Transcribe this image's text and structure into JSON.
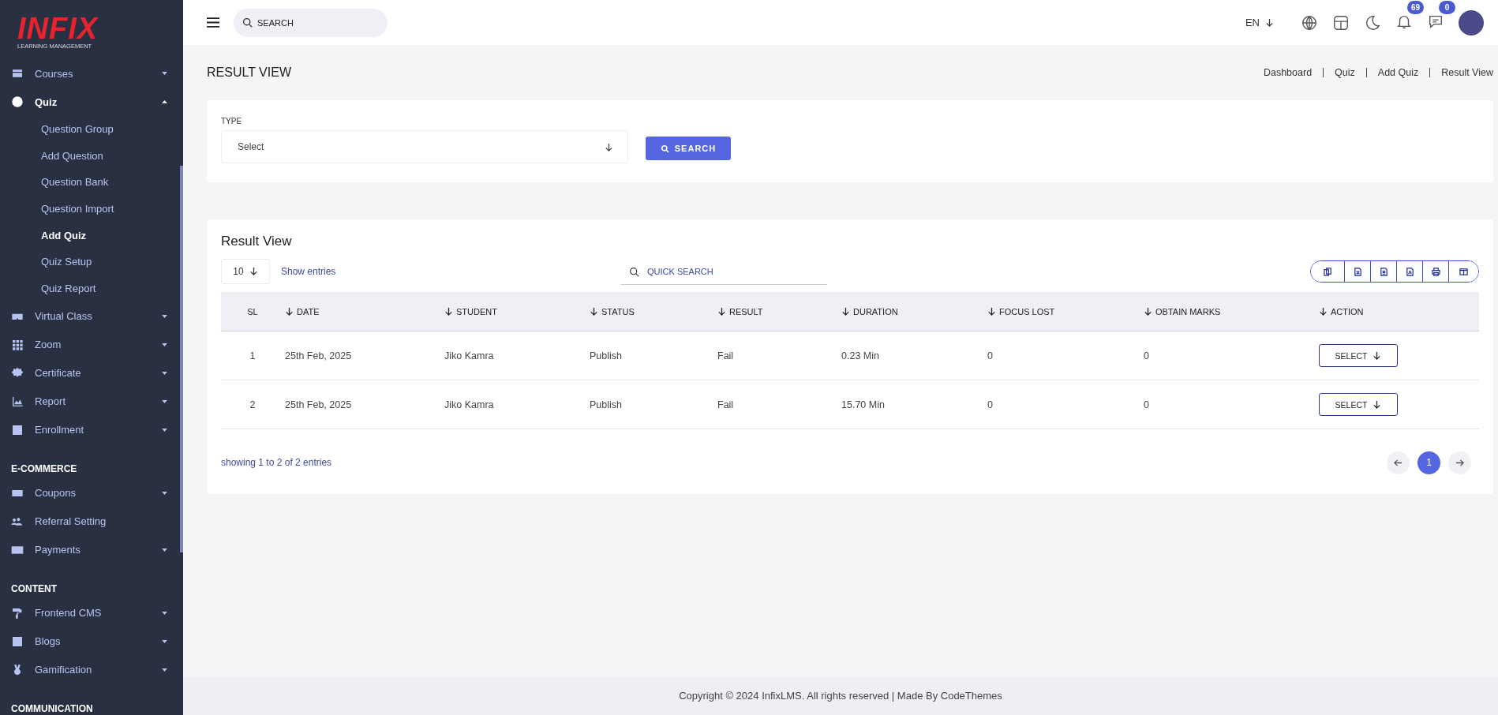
{
  "sidebar": {
    "logo": {
      "title": "INFIX",
      "subtitle": "LEARNING MANAGEMENT"
    },
    "sections": [
      {
        "items": [
          {
            "label": "Courses",
            "expanded": false,
            "selected": false
          },
          {
            "label": "Quiz",
            "expanded": true,
            "selected": true,
            "children": [
              {
                "label": "Question Group",
                "selected": false
              },
              {
                "label": "Add Question",
                "selected": false
              },
              {
                "label": "Question Bank",
                "selected": false
              },
              {
                "label": "Question Import",
                "selected": false
              },
              {
                "label": "Add Quiz",
                "selected": true
              },
              {
                "label": "Quiz Setup",
                "selected": false
              },
              {
                "label": "Quiz Report",
                "selected": false
              }
            ]
          },
          {
            "label": "Virtual Class",
            "expanded": false,
            "selected": false
          },
          {
            "label": "Zoom",
            "expanded": false,
            "selected": false
          },
          {
            "label": "Certificate",
            "expanded": false,
            "selected": false
          },
          {
            "label": "Report",
            "expanded": false,
            "selected": false
          },
          {
            "label": "Enrollment",
            "expanded": false,
            "selected": false
          }
        ]
      },
      {
        "heading": "E-COMMERCE",
        "items": [
          {
            "label": "Coupons",
            "expanded": false,
            "selected": false
          },
          {
            "label": "Referral Setting",
            "selected": false
          },
          {
            "label": "Payments",
            "expanded": false,
            "selected": false
          }
        ]
      },
      {
        "heading": "CONTENT",
        "items": [
          {
            "label": "Frontend CMS",
            "expanded": false,
            "selected": false
          },
          {
            "label": "Blogs",
            "expanded": false,
            "selected": false
          },
          {
            "label": "Gamification",
            "expanded": false,
            "selected": false
          }
        ]
      },
      {
        "heading": "COMMUNICATION"
      }
    ]
  },
  "topbar": {
    "search": {
      "placeholder": "SEARCH"
    },
    "language": "EN",
    "notifications": "69",
    "messages": "0"
  },
  "page_title": "RESULT VIEW",
  "breadcrumb": [
    "Dashboard",
    "Quiz",
    "Add Quiz",
    "Result View"
  ],
  "filter": {
    "label": "TYPE",
    "select": "Select",
    "button": "SEARCH"
  },
  "table_card": {
    "title": "Result View",
    "page_size": "10",
    "show_entries": "Show entries",
    "quick_search": {
      "placeholder": "QUICK SEARCH"
    },
    "columns": [
      {
        "label": "SL",
        "sortable": false
      },
      {
        "label": "DATE",
        "sortable": true
      },
      {
        "label": "STUDENT",
        "sortable": true
      },
      {
        "label": "STATUS",
        "sortable": true
      },
      {
        "label": "RESULT",
        "sortable": true
      },
      {
        "label": "DURATION",
        "sortable": true
      },
      {
        "label": "FOCUS LOST",
        "sortable": true
      },
      {
        "label": "OBTAIN MARKS",
        "sortable": true
      },
      {
        "label": "ACTION",
        "sortable": true
      }
    ],
    "rows": [
      {
        "cells": [
          "1",
          "25th Feb, 2025",
          "Jiko Kamra",
          "Publish",
          "Fail",
          "0.23 Min",
          "0",
          "0"
        ],
        "action": "SELECT"
      },
      {
        "cells": [
          "2",
          "25th Feb, 2025",
          "Jiko Kamra",
          "Publish",
          "Fail",
          "15.70 Min",
          "0",
          "0"
        ],
        "action": "SELECT"
      }
    ],
    "summary": "showing 1 to 2 of 2 entries",
    "pages": [
      {
        "label": "1",
        "selected": true
      }
    ]
  },
  "footer": "Copyright © 2024 InfixLMS. All rights reserved | Made By CodeThemes"
}
